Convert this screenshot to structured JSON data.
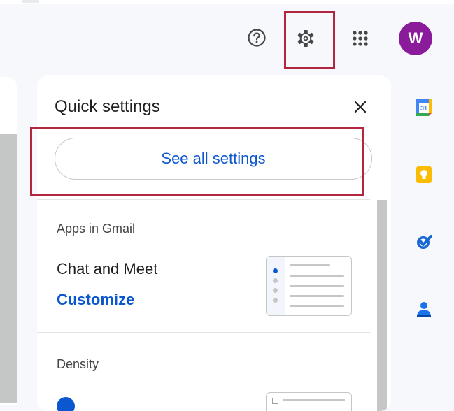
{
  "header": {
    "help_icon": "help-circle-icon",
    "settings_icon": "gear-icon",
    "apps_icon": "grid-icon",
    "avatar_initial": "W",
    "avatar_color": "#8a1c9c"
  },
  "quick_settings": {
    "title": "Quick settings",
    "close_icon": "close-icon",
    "see_all_label": "See all settings",
    "apps_section": {
      "heading": "Apps in Gmail",
      "item_label": "Chat and Meet",
      "customize_label": "Customize"
    },
    "density_section": {
      "heading": "Density"
    }
  },
  "side_panel": {
    "apps": [
      {
        "name": "calendar-icon",
        "text": "31"
      },
      {
        "name": "keep-icon"
      },
      {
        "name": "tasks-icon"
      },
      {
        "name": "contacts-icon"
      }
    ]
  },
  "colors": {
    "accent_blue": "#0b57d0",
    "highlight_red": "#b3263f",
    "background": "#f6f8fc"
  }
}
